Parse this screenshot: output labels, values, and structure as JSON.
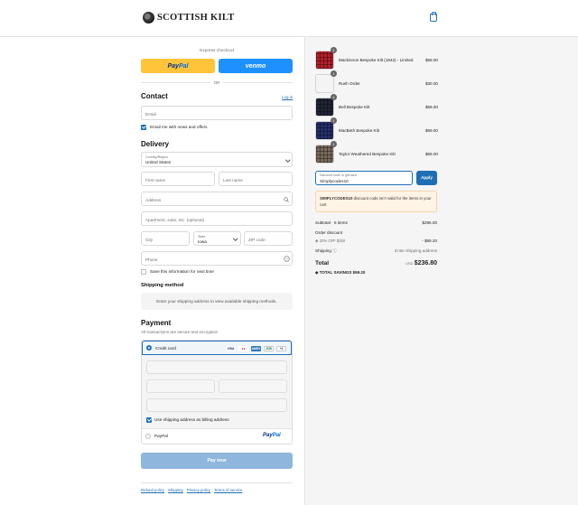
{
  "header": {
    "brand": "SCOTTISH KILT"
  },
  "express": {
    "title": "Express checkout",
    "paypal_a": "Pay",
    "paypal_b": "Pal",
    "venmo": "venmo",
    "or": "OR"
  },
  "contact": {
    "title": "Contact",
    "login": "Log in",
    "email_placeholder": "Email",
    "newsletter_label": "Email me with news and offers"
  },
  "delivery": {
    "title": "Delivery",
    "country_label": "Country/Region",
    "country_value": "United States",
    "first_name": "First name",
    "last_name": "Last name",
    "address": "Address",
    "apartment": "Apartment, suite, etc. (optional)",
    "city": "City",
    "state_label": "State",
    "state_value": "Iowa",
    "zip": "ZIP code",
    "phone": "Phone",
    "save_label": "Save this information for next time"
  },
  "shipping": {
    "title": "Shipping method",
    "notice": "Enter your shipping address to view available shipping methods."
  },
  "payment": {
    "title": "Payment",
    "subtitle": "All transactions are secure and encrypted.",
    "credit_card": "Credit card",
    "cards": [
      "VISA",
      "MC",
      "AMEX",
      "JCB",
      "+4"
    ],
    "billing_label": "Use shipping address as billing address",
    "paypal": "PayPal",
    "paypal_logo_a": "Pay",
    "paypal_logo_b": "Pal"
  },
  "pay_now": "Pay now",
  "footer": [
    "Refund policy",
    "Shipping",
    "Privacy policy",
    "Terms of service"
  ],
  "order": {
    "items": [
      {
        "name": "Mackinnon Bespoke Kilt (1842) - Limited",
        "price": "$59.00",
        "qty": "1",
        "swatch": "#b3202a"
      },
      {
        "name": "Rush Order",
        "price": "$30.00",
        "qty": "1",
        "swatch": "#f4f4f4"
      },
      {
        "name": "Bell Bespoke Kilt",
        "price": "$69.00",
        "qty": "1",
        "swatch": "#1e2535"
      },
      {
        "name": "MacBeth Bespoke Kilt",
        "price": "$69.00",
        "qty": "1",
        "swatch": "#23306a"
      },
      {
        "name": "Taylor Weathered Bespoke Kilt",
        "price": "$69.00",
        "qty": "1",
        "swatch": "#7a6a5c"
      }
    ],
    "discount_label": "Discount code or gift card",
    "discount_value": "Simplycodes10",
    "apply": "Apply",
    "warning_code": "SIMPLYCODES10",
    "warning_text": " discount code isn't valid for the items in your cart",
    "subtotal_label": "Subtotal · 5 items",
    "subtotal": "$296.00",
    "order_discount_label": "Order discount",
    "discount_tag": "20% OFF $250",
    "discount_amount": "- $59.20",
    "shipping_label": "Shipping",
    "shipping_value": "Enter shipping address",
    "total_label": "Total",
    "currency": "USD",
    "total": "$236.80",
    "savings_label": "TOTAL SAVINGS",
    "savings": "$59.20"
  }
}
